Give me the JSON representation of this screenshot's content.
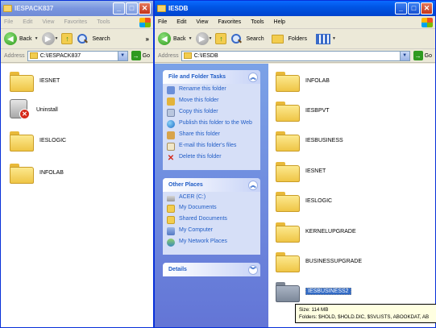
{
  "left_window": {
    "title": "IESPACK837",
    "menu": [
      "File",
      "Edit",
      "View",
      "Favorites",
      "Tools"
    ],
    "toolbar": {
      "back_label": "Back",
      "search_label": "Search"
    },
    "address": {
      "label": "Address",
      "path": "C:\\IESPACK837",
      "go_label": "Go"
    },
    "items": [
      {
        "label": "IESNET",
        "icon": "folder-icon"
      },
      {
        "label": "Uninstall",
        "icon": "uninstall-icon"
      },
      {
        "label": "IESLOGIC",
        "icon": "folder-icon"
      },
      {
        "label": "INFOLAB",
        "icon": "folder-icon"
      }
    ]
  },
  "right_window": {
    "title": "IESDB",
    "menu": [
      "File",
      "Edit",
      "View",
      "Favorites",
      "Tools",
      "Help"
    ],
    "toolbar": {
      "back_label": "Back",
      "search_label": "Search",
      "folders_label": "Folders"
    },
    "address": {
      "label": "Address",
      "path": "C:\\IESDB",
      "go_label": "Go"
    },
    "file_tasks": {
      "header": "File and Folder Tasks",
      "items": [
        "Rename this folder",
        "Move this folder",
        "Copy this folder",
        "Publish this folder to the Web",
        "Share this folder",
        "E-mail this folder's files",
        "Delete this folder"
      ]
    },
    "other_places": {
      "header": "Other Places",
      "items": [
        "ACER (C:)",
        "My Documents",
        "Shared Documents",
        "My Computer",
        "My Network Places"
      ]
    },
    "details": {
      "header": "Details"
    },
    "items": [
      {
        "label": "INFOLAB",
        "selected": false
      },
      {
        "label": "IESBPVT",
        "selected": false
      },
      {
        "label": "IESBUSINESS",
        "selected": false
      },
      {
        "label": "IESNET",
        "selected": false
      },
      {
        "label": "IESLOGIC",
        "selected": false
      },
      {
        "label": "KERNELUPGRADE",
        "selected": false
      },
      {
        "label": "BUSINESSUPGRADE",
        "selected": false
      },
      {
        "label": "IESBUSINESS2",
        "selected": true
      }
    ]
  },
  "tooltip": {
    "line1": "Size: 114 MB",
    "line2": "Folders: $HOLD, $HOLD.DIC, $SVLISTS, ABOOKDAT, AB"
  }
}
